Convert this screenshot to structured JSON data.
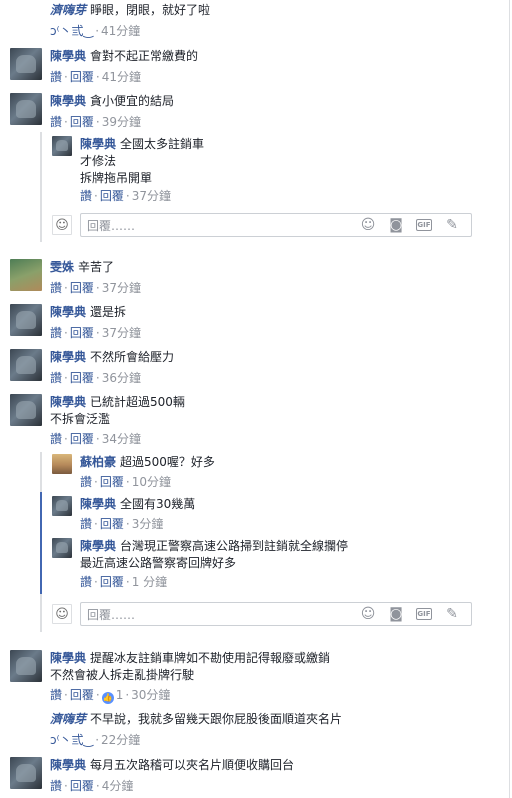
{
  "common": {
    "reply_label": "讚",
    "reply_action": "回覆",
    "reply_placeholder": "回覆……"
  },
  "c1": {
    "name": "濟嗨芽",
    "text": "睜眼，閉眼，就好了啦",
    "time": "41分鐘",
    "reply_label": "ɔ⁽丶弎‿",
    "reply_action": "回覆"
  },
  "c2": {
    "name": "陳學典",
    "text": "會對不起正常繳費的",
    "time": "41分鐘"
  },
  "c3": {
    "name": "陳學典",
    "text": "貪小便宜的結局",
    "time": "39分鐘"
  },
  "r1": {
    "name": "陳學典",
    "text": "全國太多註銷車",
    "text2": "才修法",
    "text3": "拆牌拖吊開單",
    "time": "37分鐘"
  },
  "c4": {
    "name": "雯姝",
    "text": "辛苦了",
    "time": "37分鐘"
  },
  "c5": {
    "name": "陳學典",
    "text": "還是拆",
    "time": "37分鐘"
  },
  "c6": {
    "name": "陳學典",
    "text": "不然所會給壓力",
    "time": "36分鐘"
  },
  "c7": {
    "name": "陳學典",
    "text": "已統計超過500輛",
    "text2": "不拆會泛濫",
    "time": "34分鐘"
  },
  "r2": {
    "name": "蘇柏豪",
    "text": "超過500喔？好多",
    "time": "10分鐘"
  },
  "r3": {
    "name": "陳學典",
    "text": "全國有30幾萬",
    "time": "3分鐘"
  },
  "r4": {
    "name": "陳學典",
    "text": "台灣現正警察高速公路掃到註銷就全線攔停",
    "text2": "最近高速公路警察寄回牌好多",
    "time": "1 分鐘"
  },
  "c8": {
    "name": "陳學典",
    "text": "提醒冰友註銷車牌如不勘使用記得報廢或繳銷",
    "text2": "不然會被人拆走亂掛牌行駛",
    "likes": "1",
    "time": "30分鐘"
  },
  "c9": {
    "name": "濟嗨芽",
    "text": "不早說，我就多留幾天跟你屁股後面順道夾名片",
    "time": "22分鐘",
    "reply_label": "ɔ⁽丶弎‿",
    "reply_action": "回覆"
  },
  "c10": {
    "name": "陳學典",
    "text": "每月五次路稽可以夾名片順便收購回台",
    "time": "4分鐘"
  },
  "icons": {
    "emoji": "smiley-icon",
    "camera": "camera-icon",
    "gif": "gif-icon",
    "sticker": "sticker-icon"
  },
  "colors": {
    "link": "#365899",
    "meta": "#90949c",
    "border": "#dddfe2",
    "like": "#5890ff",
    "active_thread": "#4267b2"
  }
}
